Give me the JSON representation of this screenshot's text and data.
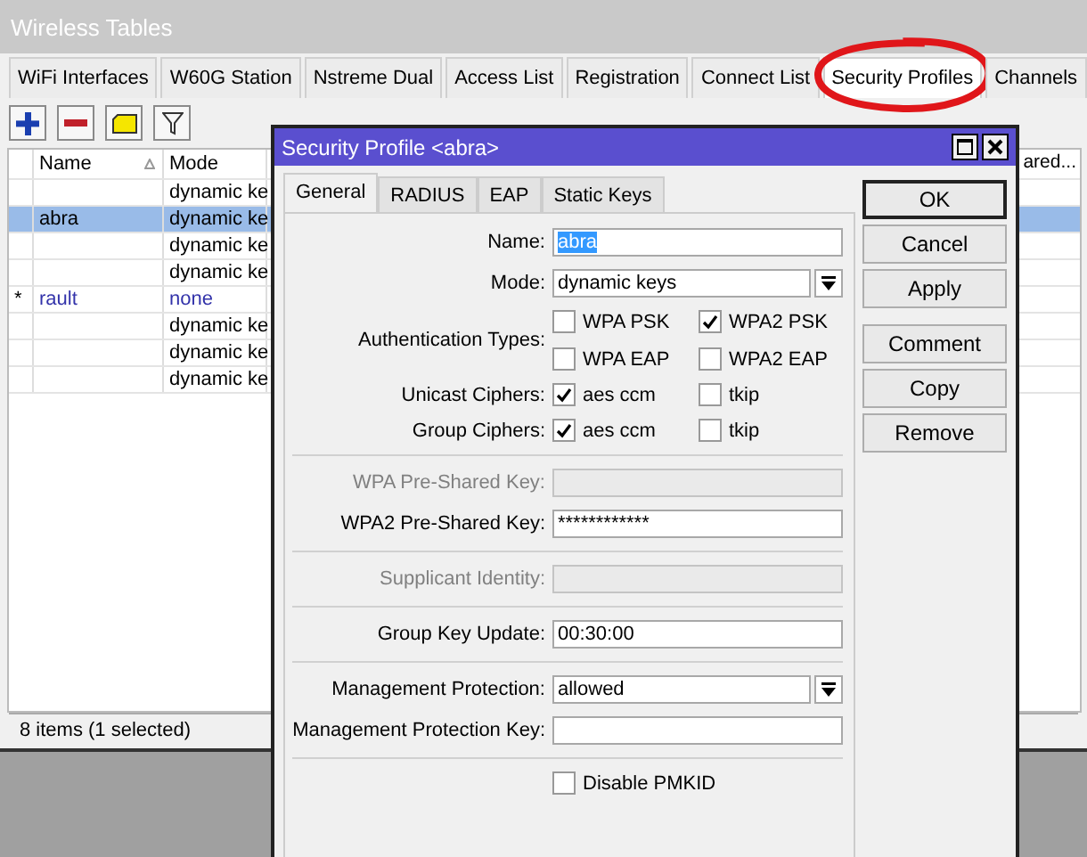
{
  "window": {
    "title": "Wireless Tables"
  },
  "tabs": [
    {
      "label": "WiFi Interfaces",
      "selected": false,
      "circled": false
    },
    {
      "label": "W60G Station",
      "selected": false,
      "circled": false
    },
    {
      "label": "Nstreme Dual",
      "selected": false,
      "circled": false
    },
    {
      "label": "Access List",
      "selected": false,
      "circled": false
    },
    {
      "label": "Registration",
      "selected": false,
      "circled": false
    },
    {
      "label": "Connect List",
      "selected": false,
      "circled": false
    },
    {
      "label": "Security Profiles",
      "selected": true,
      "circled": true
    },
    {
      "label": "Channels",
      "selected": false,
      "circled": false
    }
  ],
  "table": {
    "columns": [
      {
        "label": "Name",
        "sorted": true
      },
      {
        "label": "Mode"
      },
      {
        "label": "ared..."
      }
    ],
    "rows": [
      {
        "mode": "dynamic ke",
        "selected": false,
        "kind": "normal"
      },
      {
        "name": "abra",
        "mode": "dynamic ke",
        "selected": true,
        "kind": "normal"
      },
      {
        "mode": "dynamic ke",
        "selected": false,
        "kind": "normal"
      },
      {
        "mode": "dynamic ke",
        "selected": false,
        "kind": "normal"
      },
      {
        "marker": "*",
        "name": "rault",
        "mode": "none",
        "selected": false,
        "kind": "default"
      },
      {
        "mode": "dynamic ke",
        "selected": false,
        "kind": "normal"
      },
      {
        "mode": "dynamic ke",
        "selected": false,
        "kind": "normal"
      },
      {
        "mode": "dynamic ke",
        "selected": false,
        "kind": "normal"
      }
    ]
  },
  "status_bar": "8 items (1 selected)",
  "dialog": {
    "title": "Security Profile <abra>",
    "tabs": [
      {
        "label": "General",
        "selected": true
      },
      {
        "label": "RADIUS",
        "selected": false
      },
      {
        "label": "EAP",
        "selected": false
      },
      {
        "label": "Static Keys",
        "selected": false
      }
    ],
    "fields": [
      {
        "kind": "text",
        "label": "Name:",
        "value": "abra",
        "value_selected": true,
        "disabled": false
      },
      {
        "kind": "select",
        "label": "Mode:",
        "value": "dynamic keys"
      },
      {
        "kind": "checks",
        "label": "Authentication Types:",
        "options": [
          {
            "label": "WPA PSK",
            "checked": false
          },
          {
            "label": "WPA2 PSK",
            "checked": true
          },
          {
            "label": "WPA EAP",
            "checked": false
          },
          {
            "label": "WPA2 EAP",
            "checked": false
          }
        ]
      },
      {
        "kind": "checks",
        "label": "Unicast Ciphers:",
        "options": [
          {
            "label": "aes ccm",
            "checked": true
          },
          {
            "label": "tkip",
            "checked": false
          }
        ]
      },
      {
        "kind": "checks",
        "label": "Group Ciphers:",
        "options": [
          {
            "label": "aes ccm",
            "checked": true
          },
          {
            "label": "tkip",
            "checked": false
          }
        ]
      },
      {
        "kind": "divider"
      },
      {
        "kind": "text",
        "label": "WPA Pre-Shared Key:",
        "disabled": true
      },
      {
        "kind": "text",
        "label": "WPA2 Pre-Shared Key:",
        "value": "************",
        "disabled": false
      },
      {
        "kind": "divider"
      },
      {
        "kind": "text",
        "label": "Supplicant Identity:",
        "disabled": true
      },
      {
        "kind": "divider"
      },
      {
        "kind": "text",
        "label": "Group Key Update:",
        "value": "00:30:00",
        "disabled": false
      },
      {
        "kind": "divider"
      },
      {
        "kind": "select",
        "label": "Management Protection:",
        "value": "allowed"
      },
      {
        "kind": "text",
        "label": "Management Protection Key:",
        "disabled": false
      },
      {
        "kind": "divider"
      },
      {
        "kind": "checkbox",
        "label": "Disable PMKID",
        "checked": false
      }
    ],
    "button_groups": [
      [
        {
          "label": "OK",
          "default": true
        },
        {
          "label": "Cancel",
          "default": false
        },
        {
          "label": "Apply",
          "default": false
        }
      ],
      [
        {
          "label": "Comment",
          "default": false
        },
        {
          "label": "Copy",
          "default": false
        },
        {
          "label": "Remove",
          "default": false
        }
      ]
    ]
  }
}
